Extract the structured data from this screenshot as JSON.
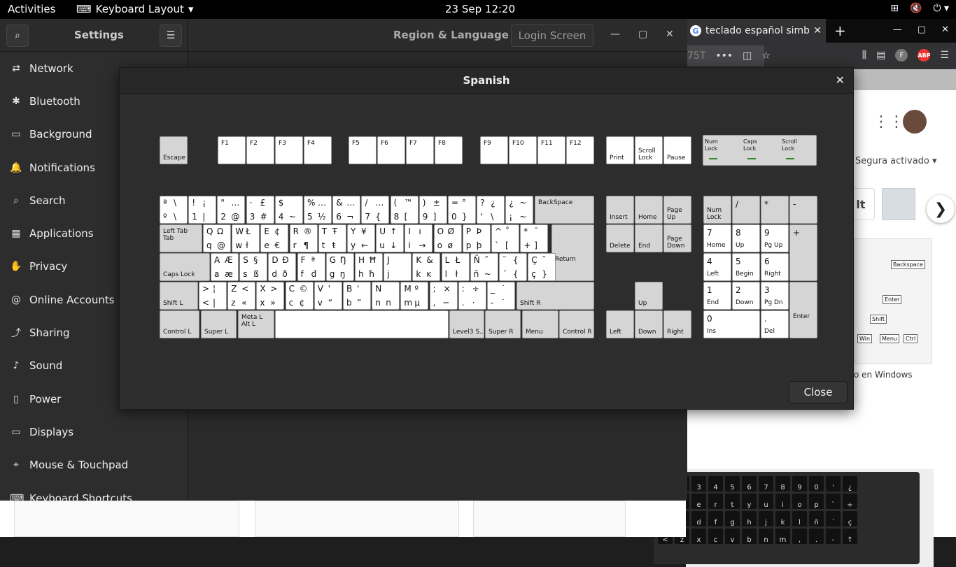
{
  "topbar": {
    "activities": "Activities",
    "app": "Keyboard Layout",
    "clock": "23 Sep  12:20"
  },
  "browser": {
    "tab_title": "teclado español simbolos",
    "url_hint": "75T",
    "segura": "Segura activado",
    "thumb_btn": "lt",
    "caption": "o en Windows"
  },
  "settings": {
    "title": "Settings",
    "region_title": "Region & Language",
    "login_screen": "Login Screen",
    "sidebar": [
      {
        "label": "Network",
        "icon": "network-icon"
      },
      {
        "label": "Bluetooth",
        "icon": "bluetooth-icon"
      },
      {
        "label": "Background",
        "icon": "background-icon"
      },
      {
        "label": "Notifications",
        "icon": "notifications-icon"
      },
      {
        "label": "Search",
        "icon": "search-icon"
      },
      {
        "label": "Applications",
        "icon": "applications-icon"
      },
      {
        "label": "Privacy",
        "icon": "privacy-icon"
      },
      {
        "label": "Online Accounts",
        "icon": "online-accounts-icon"
      },
      {
        "label": "Sharing",
        "icon": "sharing-icon"
      },
      {
        "label": "Sound",
        "icon": "sound-icon"
      },
      {
        "label": "Power",
        "icon": "power-icon"
      },
      {
        "label": "Displays",
        "icon": "displays-icon"
      },
      {
        "label": "Mouse & Touchpad",
        "icon": "mouse-icon"
      },
      {
        "label": "Keyboard Shortcuts",
        "icon": "keyboard-icon"
      }
    ]
  },
  "dialog": {
    "title": "Spanish",
    "close_label": "Close",
    "fkeys": {
      "esc": "Escape",
      "f": [
        "F1",
        "F2",
        "F3",
        "F4",
        "F5",
        "F6",
        "F7",
        "F8",
        "F9",
        "F10",
        "F11",
        "F12"
      ],
      "print": "Print",
      "scroll": "Scroll\nLock",
      "pause": "Pause"
    },
    "leds": [
      "Num\nLock",
      "Caps\nLock",
      "Scroll\nLock"
    ],
    "row1": [
      [
        "ª",
        "\\",
        "º",
        "\\"
      ],
      [
        "!",
        "¡",
        "1",
        "|"
      ],
      [
        "\"",
        "…",
        "2",
        "@"
      ],
      [
        "·",
        "£",
        "3",
        "#"
      ],
      [
        "$",
        "",
        "4",
        "~"
      ],
      [
        "%",
        "…",
        "5",
        "½"
      ],
      [
        "&",
        "…",
        "6",
        "¬"
      ],
      [
        "/",
        "…",
        "7",
        "{"
      ],
      [
        "(",
        "™",
        "8",
        "["
      ],
      [
        ")",
        "±",
        "9",
        "]"
      ],
      [
        "=",
        "°",
        "0",
        "}"
      ],
      [
        "?",
        "¿",
        "'",
        "\\"
      ],
      [
        "¿",
        "~",
        "¡",
        "~"
      ]
    ],
    "backspace": "BackSpace",
    "tab": "Left Tab\nTab",
    "row2": [
      [
        "Q",
        "Ω",
        "q",
        "@"
      ],
      [
        "W",
        "Ł",
        "w",
        "ł"
      ],
      [
        "E",
        "¢",
        "e",
        "€"
      ],
      [
        "R",
        "®",
        "r",
        "¶"
      ],
      [
        "T",
        "Ŧ",
        "t",
        "ŧ"
      ],
      [
        "Y",
        "¥",
        "y",
        "←"
      ],
      [
        "U",
        "↑",
        "u",
        "↓"
      ],
      [
        "I",
        "ı",
        "i",
        "→"
      ],
      [
        "O",
        "Ø",
        "o",
        "ø"
      ],
      [
        "P",
        "Þ",
        "p",
        "þ"
      ],
      [
        "^",
        "˚",
        "`",
        "["
      ],
      [
        "*",
        "¯",
        "+",
        "]"
      ]
    ],
    "return": "Return",
    "caps": "Caps Lock",
    "row3": [
      [
        "A",
        "Æ",
        "a",
        "æ"
      ],
      [
        "S",
        "§",
        "s",
        "ß"
      ],
      [
        "D",
        "Ð",
        "d",
        "ð"
      ],
      [
        "F",
        "ª",
        "f",
        "đ"
      ],
      [
        "G",
        "Ŋ",
        "g",
        "ŋ"
      ],
      [
        "H",
        "Ħ",
        "h",
        "ħ"
      ],
      [
        "J",
        "",
        "j",
        ""
      ],
      [
        "K",
        "&",
        "k",
        "ĸ"
      ],
      [
        "L",
        "Ł",
        "l",
        "ł"
      ],
      [
        "Ñ",
        "˝",
        "ñ",
        "~"
      ],
      [
        "¨",
        "{",
        "´",
        "{"
      ],
      [
        "Ç",
        "˘",
        "ç",
        "}"
      ]
    ],
    "shiftl": "Shift L",
    "row4": [
      [
        ">",
        "¦",
        "<",
        "|"
      ],
      [
        "Z",
        "<",
        "z",
        "«"
      ],
      [
        "X",
        ">",
        "x",
        "»"
      ],
      [
        "C",
        "©",
        "c",
        "¢"
      ],
      [
        "V",
        "'",
        "v",
        "“"
      ],
      [
        "B",
        "'",
        "b",
        "”"
      ],
      [
        "N",
        "",
        "n",
        "n"
      ],
      [
        "M",
        "º",
        "m",
        "µ"
      ],
      [
        ";",
        "×",
        ",",
        "─"
      ],
      [
        ":",
        "÷",
        ".",
        "·"
      ],
      [
        "_",
        "˙",
        "-",
        "˙"
      ]
    ],
    "shiftr": "Shift R",
    "bottom": {
      "ctrl_l": "Control L",
      "super_l": "Super L",
      "alt_l": "Meta L\nAlt L",
      "level3": "Level3 S...",
      "super_r": "Super R",
      "menu": "Menu",
      "ctrl_r": "Control R"
    },
    "nav": {
      "insert": "Insert",
      "home": "Home",
      "pgup": "Page\nUp",
      "delete": "Delete",
      "end": "End",
      "pgdn": "Page\nDown",
      "up": "Up",
      "left": "Left",
      "down": "Down",
      "right": "Right"
    },
    "numpad": {
      "numlock": "Num\nLock",
      "div": "/",
      "mul": "*",
      "minus": "-",
      "plus": "+",
      "enter": "Enter",
      "k7": [
        "7",
        "Home"
      ],
      "k8": [
        "8",
        "Up"
      ],
      "k9": [
        "9",
        "Pg Up"
      ],
      "k4": [
        "4",
        "Left"
      ],
      "k5": [
        "5",
        "Begin"
      ],
      "k6": [
        "6",
        "Right"
      ],
      "k1": [
        "1",
        "End"
      ],
      "k2": [
        "2",
        "Down"
      ],
      "k3": [
        "3",
        "Pg Dn"
      ],
      "k0": [
        "0",
        "Ins"
      ],
      "kdot": [
        ".",
        "Del"
      ]
    }
  }
}
